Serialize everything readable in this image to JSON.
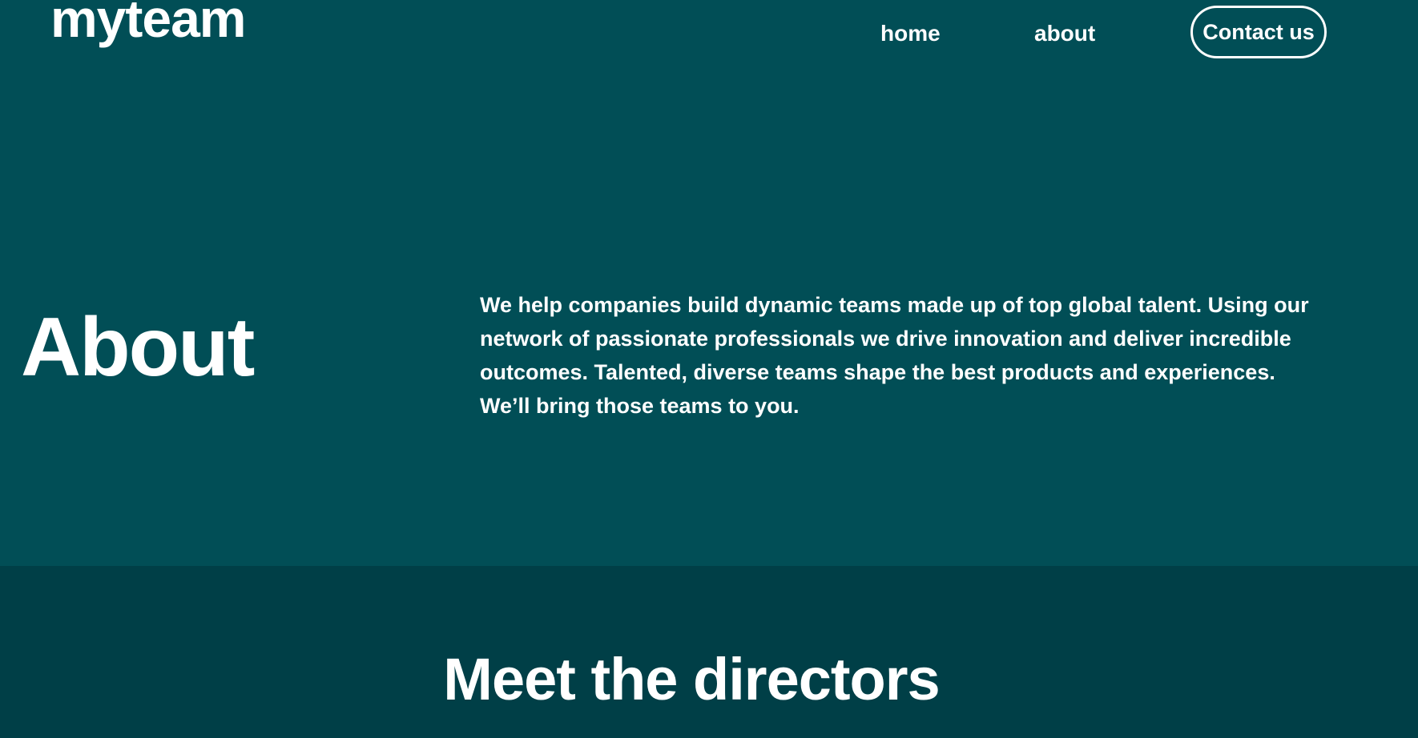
{
  "header": {
    "logo": "myteam",
    "nav": {
      "home_label": "home",
      "about_label": "about",
      "contact_label": "Contact us"
    }
  },
  "hero": {
    "title": "About",
    "description": "We help companies build dynamic teams made up of top global talent. Using our network of passionate professionals we drive innovation and deliver incredible outcomes. Talented, diverse teams shape the best products and experiences. We’ll bring those teams to you."
  },
  "directors": {
    "title": "Meet the directors"
  },
  "colors": {
    "hero_background": "#014e56",
    "directors_background": "#003f47",
    "text": "#ffffff"
  }
}
